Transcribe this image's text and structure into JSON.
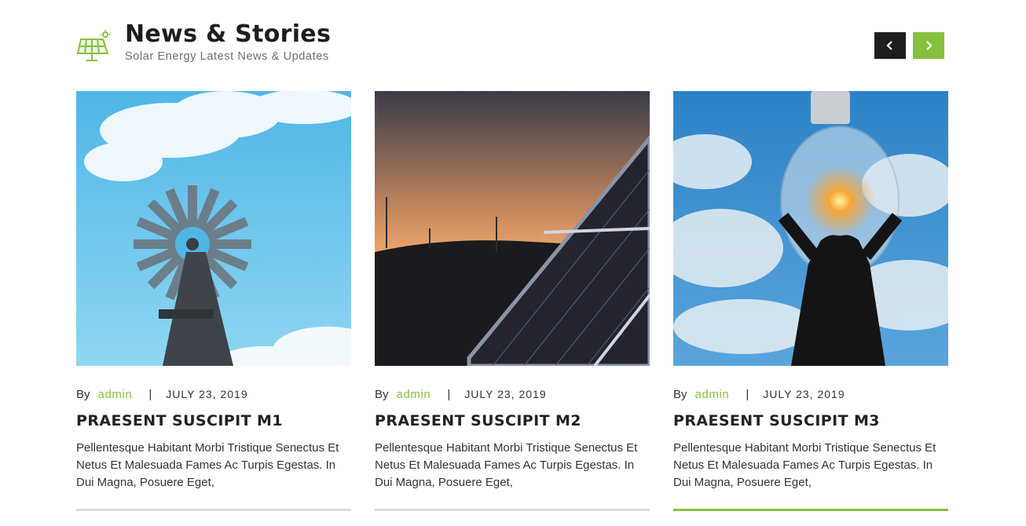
{
  "header": {
    "title": "News & Stories",
    "subtitle": "Solar Energy Latest News & Updates",
    "icon": "solar-panel-icon"
  },
  "nav": {
    "prev_icon": "chevron-left-icon",
    "next_icon": "chevron-right-icon"
  },
  "colors": {
    "accent": "#86c13e",
    "dark": "#1e1e1e"
  },
  "cards": [
    {
      "image": "windmill-sky-image",
      "by": "By",
      "author": "admin",
      "separator": "|",
      "date": "JULY 23, 2019",
      "title": "PRAESENT SUSCIPIT M1",
      "excerpt": "Pellentesque Habitant Morbi Tristique Senectus Et Netus Et Malesuada Fames Ac Turpis Egestas. In Dui Magna, Posuere Eget,"
    },
    {
      "image": "solar-panel-sunset-image",
      "by": "By",
      "author": "admin",
      "separator": "|",
      "date": "JULY 23, 2019",
      "title": "PRAESENT SUSCIPIT M2",
      "excerpt": "Pellentesque Habitant Morbi Tristique Senectus Et Netus Et Malesuada Fames Ac Turpis Egestas. In Dui Magna, Posuere Eget,"
    },
    {
      "image": "man-holding-lightbulb-image",
      "by": "By",
      "author": "admin",
      "separator": "|",
      "date": "JULY 23, 2019",
      "title": "PRAESENT SUSCIPIT M3",
      "excerpt": "Pellentesque Habitant Morbi Tristique Senectus Et Netus Et Malesuada Fames Ac Turpis Egestas. In Dui Magna, Posuere Eget,"
    }
  ]
}
